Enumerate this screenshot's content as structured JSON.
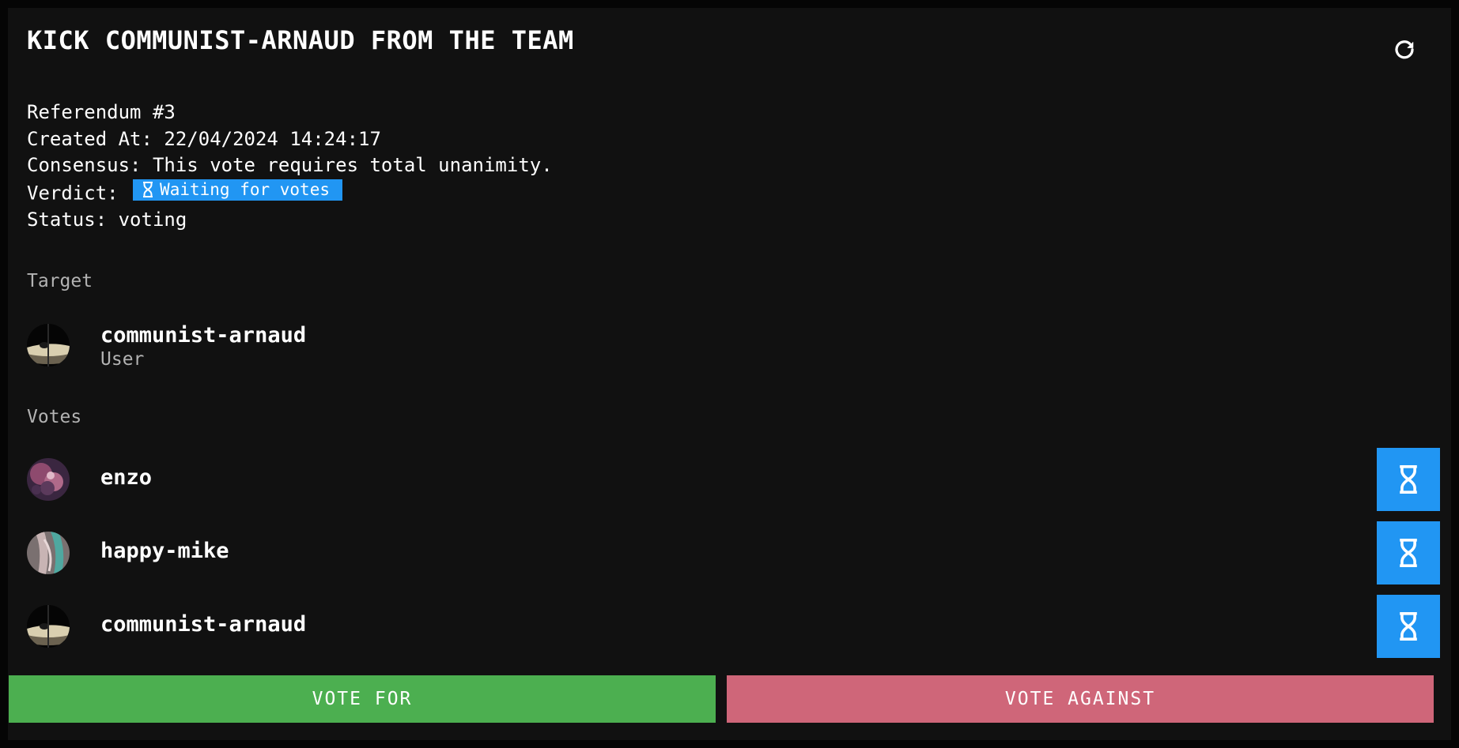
{
  "header": {
    "title": "KICK COMMUNIST-ARNAUD FROM THE TEAM",
    "refresh_icon": "refresh-icon"
  },
  "meta": {
    "referendum": "Referendum #3",
    "created_at": "Created At: 22/04/2024 14:24:17",
    "consensus": "Consensus: This vote requires total unanimity.",
    "verdict_label": "Verdict: ",
    "verdict_badge": "Waiting for votes",
    "verdict_icon": "hourglass-icon",
    "status": "Status: voting"
  },
  "target": {
    "section_label": "Target",
    "name": "communist-arnaud",
    "role": "User"
  },
  "votes": {
    "section_label": "Votes",
    "items": [
      {
        "name": "enzo",
        "status_icon": "hourglass-icon"
      },
      {
        "name": "happy-mike",
        "status_icon": "hourglass-icon"
      },
      {
        "name": "communist-arnaud",
        "status_icon": "hourglass-icon"
      }
    ]
  },
  "actions": {
    "vote_for": "VOTE FOR",
    "vote_against": "VOTE AGAINST"
  },
  "colors": {
    "background": "#111111",
    "accent_blue": "#2196f3",
    "vote_for_green": "#4caf50",
    "vote_against_pink": "#cf6679",
    "muted_text": "#b3b3b3"
  }
}
